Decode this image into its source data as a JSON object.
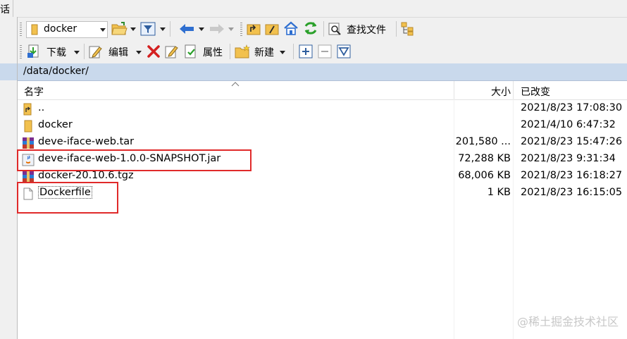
{
  "menu": {
    "fragment": "话"
  },
  "toolbar1": {
    "location": "docker",
    "find_files_label": "查找文件"
  },
  "toolbar2": {
    "download_label": "下载",
    "edit_label": "编辑",
    "properties_label": "属性",
    "new_label": "新建"
  },
  "path": "/data/docker/",
  "columns": {
    "name": "名字",
    "size": "大小",
    "modified": "已改变"
  },
  "files": [
    {
      "name": "..",
      "size": "",
      "modified": "2021/8/23 17:08:30",
      "icon": "parent-folder-icon"
    },
    {
      "name": "docker",
      "size": "",
      "modified": "2021/4/10 6:47:32",
      "icon": "folder-icon"
    },
    {
      "name": "deve-iface-web.tar",
      "size": "201,580 ...",
      "modified": "2021/8/23 15:47:26",
      "icon": "archive-icon"
    },
    {
      "name": "deve-iface-web-1.0.0-SNAPSHOT.jar",
      "size": "72,288 KB",
      "modified": "2021/8/23 9:31:34",
      "icon": "java-jar-icon"
    },
    {
      "name": "docker-20.10.6.tgz",
      "size": "68,006 KB",
      "modified": "2021/8/23 16:18:27",
      "icon": "archive-icon"
    },
    {
      "name": "Dockerfile",
      "size": "1 KB",
      "modified": "2021/8/23 16:15:05",
      "icon": "file-icon"
    }
  ],
  "watermark": "@稀土掘金技术社区",
  "colors": {
    "highlight": "#e02a2a",
    "pathbar": "#c9d9ec",
    "toolbar": "#f0f0f0"
  }
}
